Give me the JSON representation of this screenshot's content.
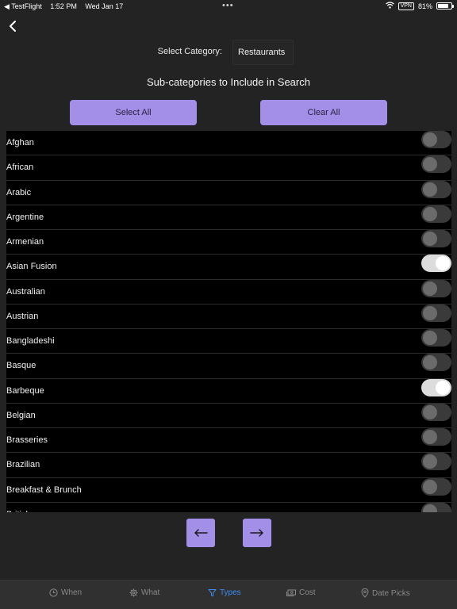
{
  "status_bar": {
    "app": "◀ TestFlight",
    "time": "1:52 PM",
    "date": "Wed Jan 17",
    "dots": "•••",
    "vpn": "VPN",
    "battery_text": "81%",
    "battery_level": 0.81
  },
  "category": {
    "label": "Select Category:",
    "value": "Restaurants"
  },
  "section_title": "Sub-categories to Include in Search",
  "actions": {
    "select_all": "Select All",
    "clear_all": "Clear All"
  },
  "subcategories": [
    {
      "label": "Afghan",
      "on": false
    },
    {
      "label": "African",
      "on": false
    },
    {
      "label": "Arabic",
      "on": false
    },
    {
      "label": "Argentine",
      "on": false
    },
    {
      "label": "Armenian",
      "on": false
    },
    {
      "label": "Asian Fusion",
      "on": true
    },
    {
      "label": "Australian",
      "on": false
    },
    {
      "label": "Austrian",
      "on": false
    },
    {
      "label": "Bangladeshi",
      "on": false
    },
    {
      "label": "Basque",
      "on": false
    },
    {
      "label": "Barbeque",
      "on": true
    },
    {
      "label": "Belgian",
      "on": false
    },
    {
      "label": "Brasseries",
      "on": false
    },
    {
      "label": "Brazilian",
      "on": false
    },
    {
      "label": "Breakfast & Brunch",
      "on": false
    },
    {
      "label": "British",
      "on": false
    }
  ],
  "navigation": {
    "prev": "←",
    "next": "→"
  },
  "tabs": [
    {
      "label": "When",
      "icon": "clock-icon",
      "active": false
    },
    {
      "label": "What",
      "icon": "gear-icon",
      "active": false
    },
    {
      "label": "Types",
      "icon": "filter-icon",
      "active": true
    },
    {
      "label": "Cost",
      "icon": "money-icon",
      "active": false
    },
    {
      "label": "Date Picks",
      "icon": "pin-icon",
      "active": false
    }
  ],
  "colors": {
    "accent": "#a38fe8",
    "tab_active": "#3d8bf2",
    "background": "#232323"
  }
}
